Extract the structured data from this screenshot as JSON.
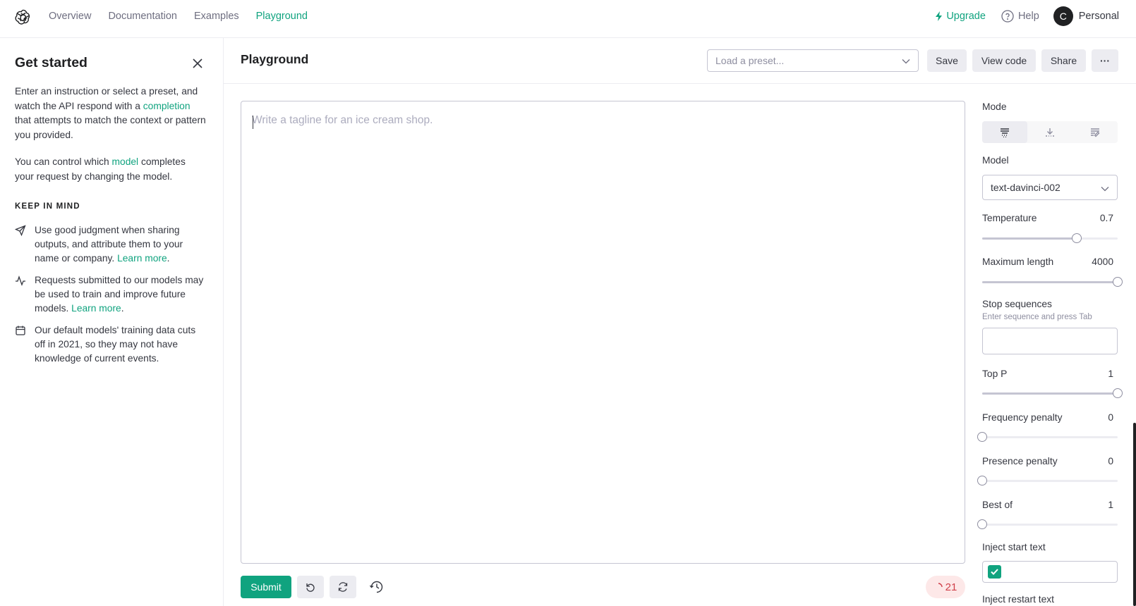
{
  "nav": {
    "links": [
      "Overview",
      "Documentation",
      "Examples",
      "Playground"
    ],
    "active": "Playground",
    "upgrade": "Upgrade",
    "help": "Help",
    "avatar_initial": "C",
    "account": "Personal"
  },
  "sidebar": {
    "title": "Get started",
    "intro_1_a": "Enter an instruction or select a preset, and watch the API respond with a ",
    "intro_1_link": "completion",
    "intro_1_b": " that attempts to match the context or pattern you provided.",
    "intro_2_a": "You can control which ",
    "intro_2_link": "model",
    "intro_2_b": " completes your request by changing the model.",
    "keep_in_mind": "KEEP IN MIND",
    "items": [
      {
        "icon": "send-icon",
        "text": "Use good judgment when sharing outputs, and attribute them to your name or company. ",
        "link": "Learn more",
        "after": "."
      },
      {
        "icon": "activity-icon",
        "text": "Requests submitted to our models may be used to train and improve future models. ",
        "link": "Learn more",
        "after": "."
      },
      {
        "icon": "calendar-icon",
        "text": "Our default models' training data cuts off in 2021, so they may not have knowledge of current events.",
        "link": "",
        "after": ""
      }
    ]
  },
  "main": {
    "title": "Playground",
    "preset_placeholder": "Load a preset...",
    "buttons": {
      "save": "Save",
      "view_code": "View code",
      "share": "Share",
      "more": "···"
    },
    "editor_placeholder": "Write a tagline for an ice cream shop.",
    "submit": "Submit",
    "token_count": "21"
  },
  "settings": {
    "mode_label": "Mode",
    "modes": [
      "complete-icon",
      "insert-icon",
      "edit-icon"
    ],
    "active_mode": 0,
    "model_label": "Model",
    "model_value": "text-davinci-002",
    "temperature": {
      "label": "Temperature",
      "value": "0.7",
      "fraction": 0.7
    },
    "max_length": {
      "label": "Maximum length",
      "value": "4000",
      "fraction": 1.0
    },
    "stop_sequences": {
      "label": "Stop sequences",
      "hint": "Enter sequence and press Tab"
    },
    "top_p": {
      "label": "Top P",
      "value": "1",
      "fraction": 1.0
    },
    "frequency_penalty": {
      "label": "Frequency penalty",
      "value": "0",
      "fraction": 0.0
    },
    "presence_penalty": {
      "label": "Presence penalty",
      "value": "0",
      "fraction": 0.0
    },
    "best_of": {
      "label": "Best of",
      "value": "1",
      "fraction": 0.0
    },
    "inject_start": {
      "label": "Inject start text",
      "checked": true
    },
    "inject_restart": {
      "label": "Inject restart text"
    }
  },
  "colors": {
    "accent": "#10a37f",
    "token_bg": "#fde8e8",
    "token_fg": "#d0404a"
  }
}
